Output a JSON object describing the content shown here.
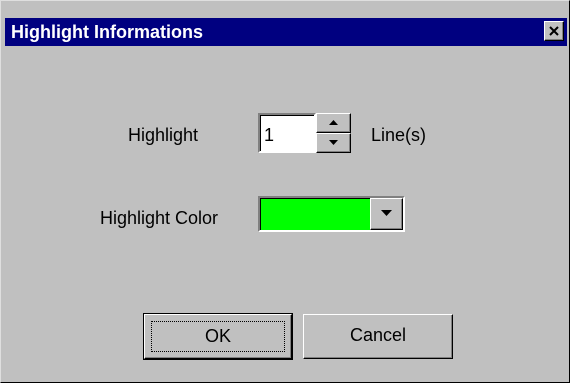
{
  "window": {
    "title": "Highlight Informations",
    "close_glyph": "close-icon"
  },
  "highlight": {
    "label": "Highlight",
    "value": "1",
    "unit_label": "Line(s)",
    "spin_up_icon": "spin-up-arrow-icon",
    "spin_down_icon": "spin-down-arrow-icon"
  },
  "color": {
    "label": "Highlight Color",
    "selected_color": "#00ff00",
    "dropdown_icon": "chevron-down-icon"
  },
  "buttons": {
    "ok_label": "OK",
    "cancel_label": "Cancel"
  },
  "theme": {
    "titlebar": "#000080",
    "face": "#c0c0c0"
  }
}
